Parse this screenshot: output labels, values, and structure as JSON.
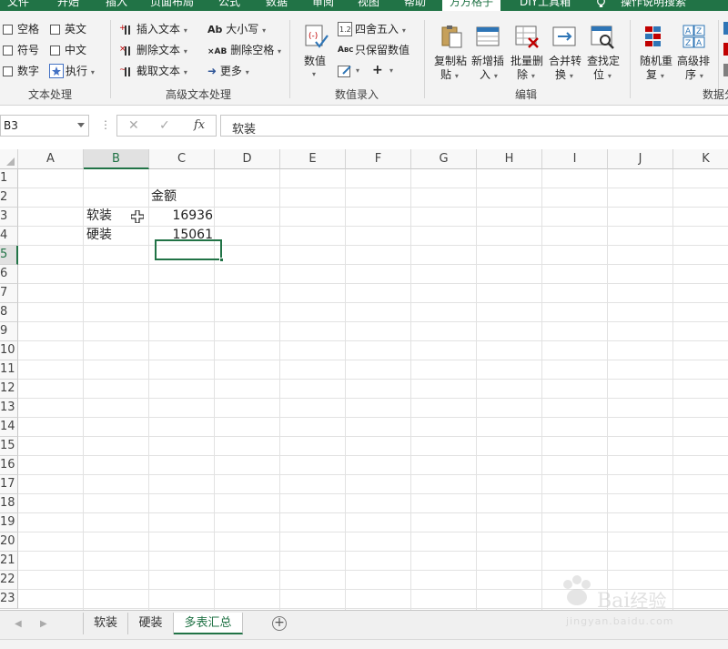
{
  "menu": {
    "tabs": [
      "文件",
      "开始",
      "插入",
      "页面布局",
      "公式",
      "数据",
      "审阅",
      "视图",
      "帮助",
      "方方格子",
      "DIY工具箱",
      "操作说明搜索"
    ],
    "active_tab": "方方格子"
  },
  "ribbon": {
    "text_processing": {
      "group_label": "文本处理",
      "checks": [
        "空格",
        "英文",
        "符号",
        "中文",
        "数字"
      ],
      "execute": "执行"
    },
    "advanced_text": {
      "group_label": "高级文本处理",
      "insert_text": "插入文本",
      "delete_text": "删除文本",
      "extract_text": "截取文本",
      "case": "大小写",
      "delete_space": "删除空格",
      "more": "更多",
      "case_prefix": "Ab",
      "delete_space_prefix": "×AB"
    },
    "number_entry": {
      "group_label": "数值录入",
      "value": "数值",
      "round": "四舍五入",
      "keep_numbers": "只保留数值",
      "plus": "+"
    },
    "edit": {
      "group_label": "编辑",
      "copy_paste": [
        "复制粘",
        "贴"
      ],
      "add_insert": [
        "新增插",
        "入"
      ],
      "batch_delete": [
        "批量删",
        "除"
      ],
      "merge_convert": [
        "合并转",
        "换"
      ],
      "find_locate": [
        "查找定",
        "位"
      ]
    },
    "data_analysis": {
      "group_label": "数据分",
      "random_repeat": [
        "随机重",
        "复"
      ],
      "advanced_sort": [
        "高级排",
        "序"
      ]
    }
  },
  "formula_bar": {
    "name_box": "B3",
    "content": "软装",
    "cancel": "✕",
    "confirm": "✓",
    "fx": "fx"
  },
  "sheet": {
    "columns": [
      "A",
      "B",
      "C",
      "D",
      "E",
      "F",
      "G",
      "H",
      "I",
      "J",
      "K"
    ],
    "rows": [
      "1",
      "2",
      "3",
      "4",
      "5",
      "6",
      "7",
      "8",
      "9",
      "10",
      "11",
      "12",
      "13",
      "14",
      "15",
      "16",
      "17",
      "18",
      "19",
      "20",
      "21",
      "22",
      "23"
    ],
    "cells": {
      "C2": "金额",
      "B3": "软装",
      "C3": "16936",
      "B4": "硬装",
      "C4": "15061"
    }
  },
  "sheet_tabs": [
    "软装",
    "硬装",
    "多表汇总"
  ],
  "active_sheet": "多表汇总",
  "watermark": {
    "brand": "Bai",
    "brand_cn": "经验",
    "url": "jingyan.baidu.com"
  }
}
